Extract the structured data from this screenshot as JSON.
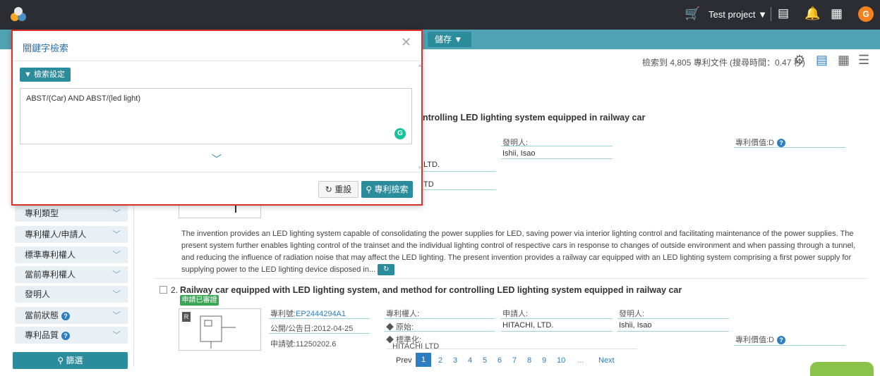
{
  "topbar": {
    "project_label": "Test project ▼",
    "avatar_letter": "G",
    "accent": "#f58220"
  },
  "toolbar": {
    "save_label": "儲存 ▼"
  },
  "results": {
    "count_text": "檢索到 4,805 專利文件 (搜尋時間：0.47 秒)"
  },
  "modal": {
    "title": "關鍵字檢索",
    "settings_label": "檢索設定",
    "query": "ABST/(Car) AND ABST/(led light)",
    "reset_label": "重設",
    "search_label": "專利檢索",
    "border_color": "#d9302c"
  },
  "sidebar": {
    "filters": [
      {
        "label": "專利類型"
      },
      {
        "label": "專利權人/申請人"
      },
      {
        "label": "標準專利權人"
      },
      {
        "label": "當前專利權人"
      },
      {
        "label": "發明人"
      },
      {
        "label": "當前狀態",
        "help": "?"
      },
      {
        "label": "專利品質",
        "help": "?"
      }
    ],
    "filter_button": "篩選"
  },
  "result1": {
    "title_fragment": "ntrolling LED lighting system equipped in railway car",
    "inventor_label": "發明人:",
    "inventor": "Ishii, Isao",
    "value_label": "專利價值:D",
    "assignee_frag1": "LTD.",
    "assignee_frag2": "TD",
    "abstract": "The invention provides an LED lighting system capable of consolidating the power supplies for LED, saving power via interior lighting control and facilitating maintenance of the power supplies. The present system further enables lighting control of the trainset and the individual lighting control of respective cars in response to changes of outside environment and when passing through a tunnel, and reducing the influence of radiation noise that may affect the LED lighting. The present invention provides a railway car equipped with an LED lighting system comprising a first power supply for supplying power to the LED lighting device disposed in..."
  },
  "result2": {
    "index": "2.",
    "title": "Railway car equipped with LED lighting system, and method for controlling LED lighting system equipped in railway car",
    "badge": "申請已審證",
    "patent_no_label": "專利號:",
    "patent_no": "EP2444294A1",
    "pub_date": "公開/公告日:2012-04-25",
    "app_no": "申請號:11250202.6",
    "assignee_label": "專利權人:",
    "original_label": "◆ 原始:",
    "standard_label": "◆ 標準化:",
    "standard_value": "HITACHI LTD",
    "applicant_label": "申請人:",
    "applicant": "HITACHI, LTD.",
    "inventor_label": "發明人:",
    "inventor": "Ishii, Isao",
    "value_label": "專利價值:D",
    "thumb_tag": "R"
  },
  "pager": {
    "prev": "Prev",
    "pages": [
      "1",
      "2",
      "3",
      "4",
      "5",
      "6",
      "7",
      "8",
      "9",
      "10",
      "..."
    ],
    "next": "Next"
  }
}
